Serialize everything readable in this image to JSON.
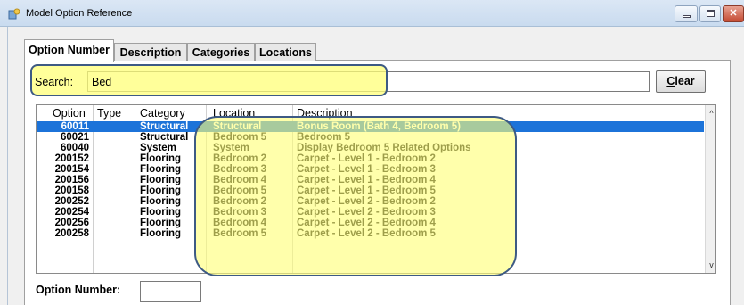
{
  "window": {
    "title": "Model Option Reference",
    "minimize_icon": "minimize-icon",
    "maximize_icon": "maximize-icon",
    "close_icon": "close-icon",
    "close_glyph": "✕"
  },
  "tabs": [
    {
      "label": "Option Number",
      "active": true
    },
    {
      "label": "Description",
      "active": false
    },
    {
      "label": "Categories",
      "active": false
    },
    {
      "label": "Locations",
      "active": false
    }
  ],
  "search": {
    "label_prefix": "Se",
    "label_underlined": "a",
    "label_suffix": "rch:",
    "value": "Bed",
    "clear_underlined": "C",
    "clear_rest": "lear"
  },
  "grid": {
    "columns": [
      "Option",
      "Type",
      "Category",
      "Location",
      "Description"
    ],
    "rows": [
      {
        "option": "60011",
        "type": "",
        "category": "Structural",
        "location": "Structural",
        "description": "Bonus Room (Bath 4, Bedroom 5)",
        "selected": true
      },
      {
        "option": "60021",
        "type": "",
        "category": "Structural",
        "location": "Bedroom 5",
        "description": "Bedroom 5",
        "selected": false
      },
      {
        "option": "60040",
        "type": "",
        "category": "System",
        "location": "System",
        "description": "Display Bedroom 5 Related Options",
        "selected": false
      },
      {
        "option": "200152",
        "type": "",
        "category": "Flooring",
        "location": "Bedroom 2",
        "description": "Carpet - Level 1 - Bedroom 2",
        "selected": false
      },
      {
        "option": "200154",
        "type": "",
        "category": "Flooring",
        "location": "Bedroom 3",
        "description": "Carpet - Level 1 - Bedroom 3",
        "selected": false
      },
      {
        "option": "200156",
        "type": "",
        "category": "Flooring",
        "location": "Bedroom 4",
        "description": "Carpet - Level 1 - Bedroom 4",
        "selected": false
      },
      {
        "option": "200158",
        "type": "",
        "category": "Flooring",
        "location": "Bedroom 5",
        "description": "Carpet - Level 1 - Bedroom 5",
        "selected": false
      },
      {
        "option": "200252",
        "type": "",
        "category": "Flooring",
        "location": "Bedroom 2",
        "description": "Carpet - Level 2 - Bedroom 2",
        "selected": false
      },
      {
        "option": "200254",
        "type": "",
        "category": "Flooring",
        "location": "Bedroom 3",
        "description": "Carpet - Level 2 - Bedroom 3",
        "selected": false
      },
      {
        "option": "200256",
        "type": "",
        "category": "Flooring",
        "location": "Bedroom 4",
        "description": "Carpet - Level 2 - Bedroom 4",
        "selected": false
      },
      {
        "option": "200258",
        "type": "",
        "category": "Flooring",
        "location": "Bedroom 5",
        "description": "Carpet - Level 2 - Bedroom 5",
        "selected": false
      }
    ],
    "scroll_up_glyph": "^",
    "scroll_down_glyph": "v"
  },
  "footer": {
    "option_number_label": "Option Number:",
    "option_number_value": ""
  },
  "colors": {
    "selection": "#1c73d9",
    "highlight": "#ffff78",
    "highlight_border": "#3d5a84"
  }
}
